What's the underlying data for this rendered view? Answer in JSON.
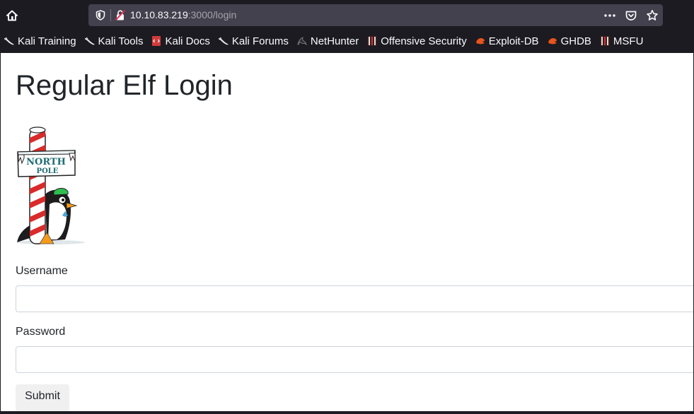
{
  "browser": {
    "url_host": "10.10.83.219",
    "url_rest": ":3000/login",
    "bookmarks": [
      {
        "label": "Kali Training",
        "icon": "kali-dragon-icon"
      },
      {
        "label": "Kali Tools",
        "icon": "kali-dragon-icon"
      },
      {
        "label": "Kali Docs",
        "icon": "kali-docs-icon"
      },
      {
        "label": "Kali Forums",
        "icon": "kali-dragon-icon"
      },
      {
        "label": "NetHunter",
        "icon": "nethunter-icon"
      },
      {
        "label": "Offensive Security",
        "icon": "offsec-icon"
      },
      {
        "label": "Exploit-DB",
        "icon": "exploit-db-icon"
      },
      {
        "label": "GHDB",
        "icon": "ghdb-icon"
      },
      {
        "label": "MSFU",
        "icon": "msfu-icon"
      }
    ]
  },
  "page": {
    "title": "Regular Elf Login",
    "logo_text_top": "NORTH",
    "logo_text_bottom": "POLE",
    "username_label": "Username",
    "password_label": "Password",
    "submit_label": "Submit"
  }
}
